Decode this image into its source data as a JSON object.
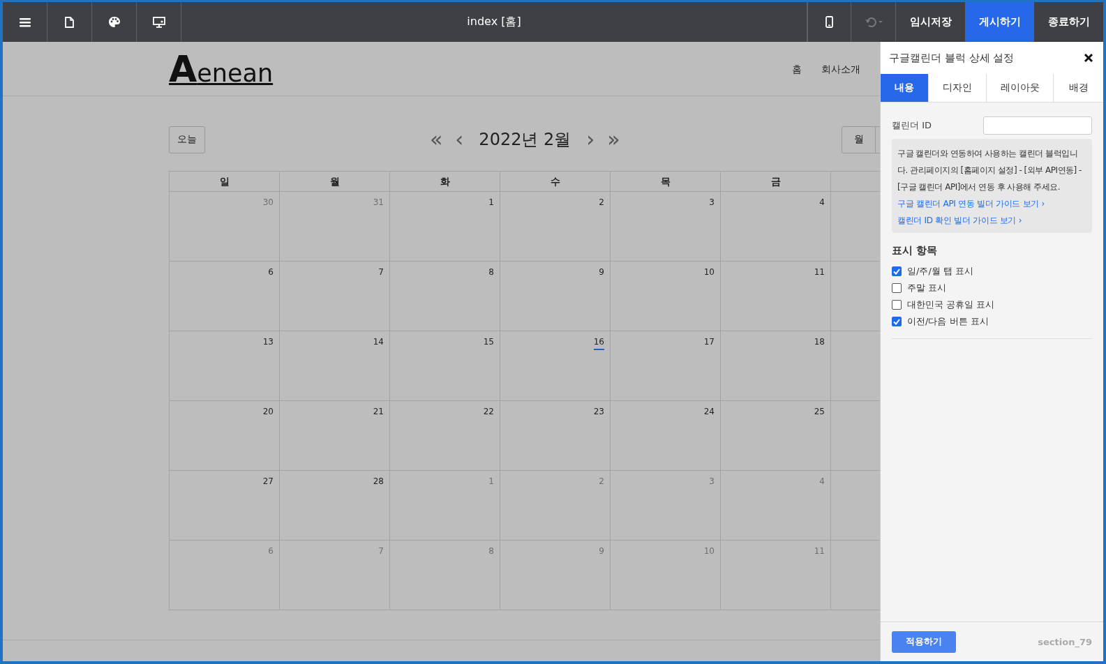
{
  "toolbar": {
    "left_icons": [
      {
        "kind": "menu"
      },
      {
        "kind": "page"
      },
      {
        "kind": "palette"
      },
      {
        "kind": "monitor"
      }
    ],
    "title": "index [홈]",
    "device_icon": {
      "kind": "phone"
    },
    "undo": {
      "disabled": true
    },
    "buttons": [
      {
        "label": "임시저장",
        "selected": false
      },
      {
        "label": "게시하기",
        "selected": true
      },
      {
        "label": "종료하기",
        "selected": false
      }
    ]
  },
  "site": {
    "logo_initial": "A",
    "logo_rest": "enean",
    "nav": [
      "홈",
      "회사소개"
    ]
  },
  "calendar": {
    "today_button": "오늘",
    "prev_year": "«",
    "prev": "‹",
    "title": "2022년 2월",
    "next": "›",
    "next_year": "»",
    "view_button": "월",
    "weekdays": [
      "일",
      "월",
      "화",
      "수",
      "목",
      "금"
    ],
    "weeks": [
      [
        {
          "day": "30",
          "other_month": true,
          "today": false
        },
        {
          "day": "31",
          "other_month": true,
          "today": false
        },
        {
          "day": "1",
          "other_month": false,
          "today": false
        },
        {
          "day": "2",
          "other_month": false,
          "today": false
        },
        {
          "day": "3",
          "other_month": false,
          "today": false
        },
        {
          "day": "4",
          "other_month": false,
          "today": false
        }
      ],
      [
        {
          "day": "6",
          "other_month": false,
          "today": false
        },
        {
          "day": "7",
          "other_month": false,
          "today": false
        },
        {
          "day": "8",
          "other_month": false,
          "today": false
        },
        {
          "day": "9",
          "other_month": false,
          "today": false
        },
        {
          "day": "10",
          "other_month": false,
          "today": false
        },
        {
          "day": "11",
          "other_month": false,
          "today": false
        }
      ],
      [
        {
          "day": "13",
          "other_month": false,
          "today": false
        },
        {
          "day": "14",
          "other_month": false,
          "today": false
        },
        {
          "day": "15",
          "other_month": false,
          "today": false
        },
        {
          "day": "16",
          "other_month": false,
          "today": true
        },
        {
          "day": "17",
          "other_month": false,
          "today": false
        },
        {
          "day": "18",
          "other_month": false,
          "today": false
        }
      ],
      [
        {
          "day": "20",
          "other_month": false,
          "today": false
        },
        {
          "day": "21",
          "other_month": false,
          "today": false
        },
        {
          "day": "22",
          "other_month": false,
          "today": false
        },
        {
          "day": "23",
          "other_month": false,
          "today": false
        },
        {
          "day": "24",
          "other_month": false,
          "today": false
        },
        {
          "day": "25",
          "other_month": false,
          "today": false
        }
      ],
      [
        {
          "day": "27",
          "other_month": false,
          "today": false
        },
        {
          "day": "28",
          "other_month": false,
          "today": false
        },
        {
          "day": "1",
          "other_month": true,
          "today": false
        },
        {
          "day": "2",
          "other_month": true,
          "today": false
        },
        {
          "day": "3",
          "other_month": true,
          "today": false
        },
        {
          "day": "4",
          "other_month": true,
          "today": false
        }
      ],
      [
        {
          "day": "6",
          "other_month": true,
          "today": false
        },
        {
          "day": "7",
          "other_month": true,
          "today": false
        },
        {
          "day": "8",
          "other_month": true,
          "today": false
        },
        {
          "day": "9",
          "other_month": true,
          "today": false
        },
        {
          "day": "10",
          "other_month": true,
          "today": false
        },
        {
          "day": "11",
          "other_month": true,
          "today": false
        }
      ]
    ]
  },
  "panel": {
    "title": "구글캘린더 블럭 상세 설정",
    "tabs": [
      {
        "label": "내용",
        "selected": true
      },
      {
        "label": "디자인",
        "selected": false
      },
      {
        "label": "레이아웃",
        "selected": false
      },
      {
        "label": "배경",
        "selected": false
      }
    ],
    "calendar_id": {
      "label": "캘린더 ID"
    },
    "info": "구글 캘린더와 연동하여 사용하는 캘린더 블럭입니다. 관리페이지의 [홈페이지 설정] - [외부 API연동] - [구글 캘린더 API]에서 연동 후 사용해 주세요.",
    "links": [
      "구글 캘린더 API 연동 빌더 가이드 보기 ›",
      "캘린더 ID 확인 빌더 가이드 보기 ›"
    ],
    "display_heading": "표시 항목",
    "options": [
      {
        "label": "일/주/월 탭 표시",
        "checked": true
      },
      {
        "label": "주말 표시",
        "checked": false
      },
      {
        "label": "대한민국 공휴일 표시",
        "checked": false
      },
      {
        "label": "이전/다음 버튼 표시",
        "checked": true
      }
    ],
    "apply_button": "적용하기",
    "section_id": "section_79"
  }
}
